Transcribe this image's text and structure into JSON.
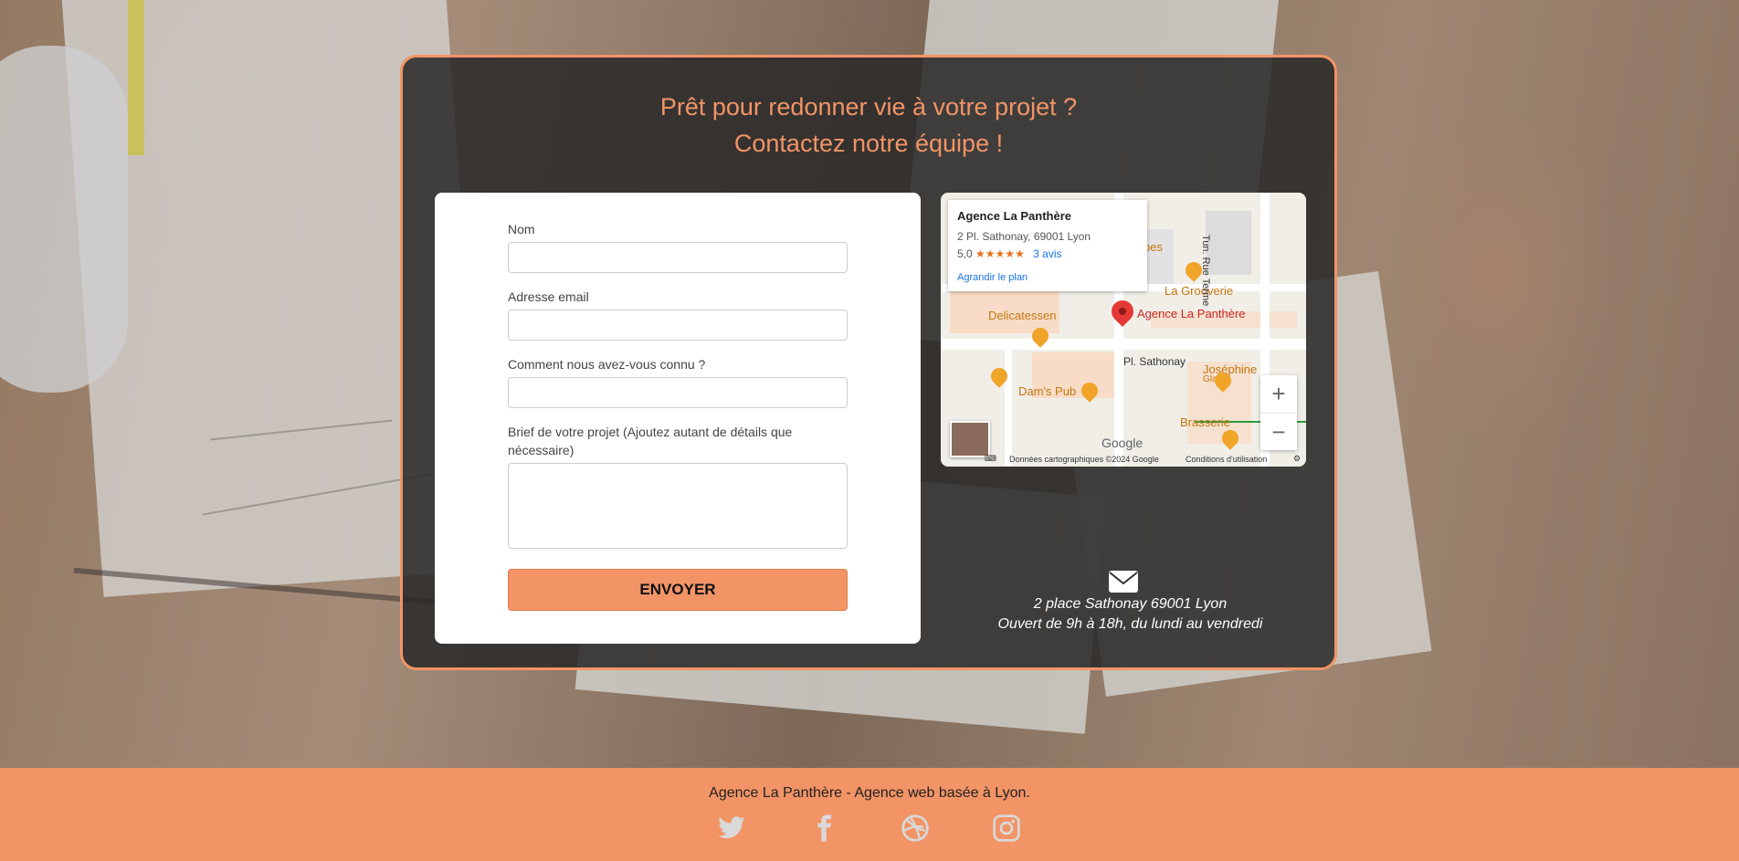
{
  "hero": {
    "heading_line1": "Prêt pour redonner vie à votre projet ?",
    "heading_line2": "Contactez notre équipe !"
  },
  "form": {
    "name_label": "Nom",
    "name_value": "",
    "email_label": "Adresse email",
    "email_value": "",
    "source_label": "Comment nous avez-vous connu ?",
    "source_value": "",
    "brief_label": "Brief de votre projet (Ajoutez autant de détails que nécessaire)",
    "brief_value": "",
    "submit_label": "ENVOYER"
  },
  "map": {
    "place_name": "Agence La Panthère",
    "place_address": "2 Pl. Sathonay, 69001 Lyon",
    "rating": "5,0",
    "stars": "★★★★★",
    "reviews_link": "3 avis",
    "enlarge_link": "Agrandir le plan",
    "pin_label": "Agence La Panthère",
    "labels": {
      "delicatessen": "Delicatessen",
      "la_grooverie": "La Grooverie",
      "pl_sathonay": "Pl. Sathonay",
      "dams_pub": "Dam's Pub",
      "brasserie": "Brasserie",
      "josephine": "Joséphine",
      "glace": "Glace",
      "rue_terme": "Tun. Rue Terme",
      "bes": "bes"
    },
    "zoom_in": "+",
    "zoom_out": "−",
    "google": "Google",
    "map_data": "Données cartographiques ©2024 Google",
    "terms": "Conditions d'utilisation"
  },
  "contact": {
    "address": "2 place Sathonay 69001 Lyon",
    "hours": "Ouvert de 9h à 18h, du lundi au vendredi"
  },
  "footer": {
    "text": "Agence La Panthère - Agence web basée à Lyon.",
    "icons": [
      "twitter-icon",
      "facebook-icon",
      "dribbble-icon",
      "instagram-icon"
    ]
  },
  "colors": {
    "accent": "#f29466",
    "panel": "#282828"
  }
}
